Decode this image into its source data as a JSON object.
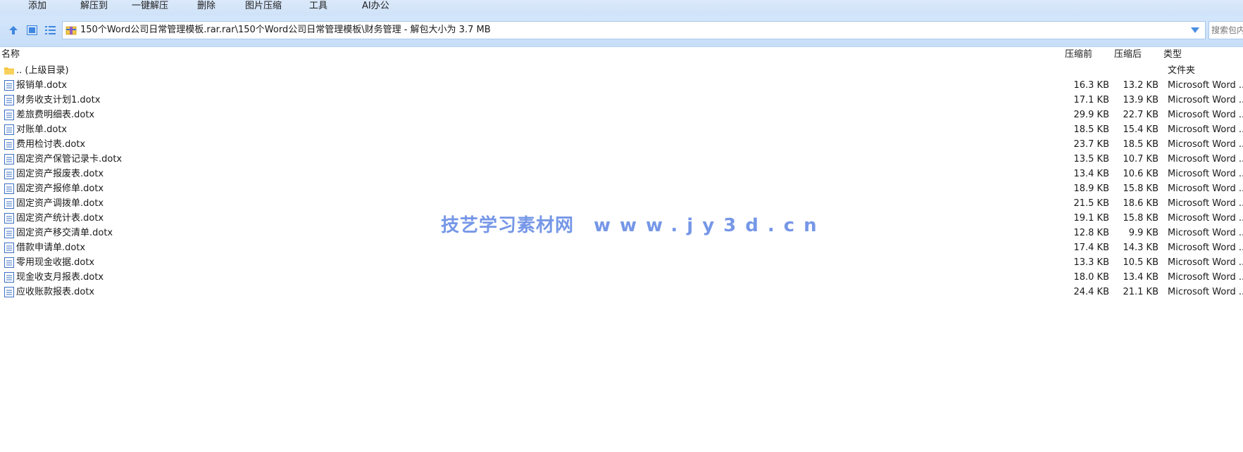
{
  "menu": {
    "items": [
      "添加",
      "解压到",
      "一键解压",
      "删除",
      "图片压缩",
      "工具",
      "AI办公"
    ]
  },
  "address": {
    "path": "150个Word公司日常管理模板.rar.rar\\150个Word公司日常管理模板\\财务管理 - 解包大小为 3.7 MB",
    "search_placeholder": "搜索包内"
  },
  "columns": {
    "name": "名称",
    "packed": "压缩前",
    "unpacked": "压缩后",
    "type": "类型"
  },
  "rows": [
    {
      "name": ".. (上级目录)",
      "packed": "",
      "unpacked": "",
      "type": "文件夹",
      "icon": "folder-icon"
    },
    {
      "name": "报销单.dotx",
      "packed": "16.3 KB",
      "unpacked": "13.2 KB",
      "type": "Microsoft Word ...",
      "icon": "document-icon"
    },
    {
      "name": "财务收支计划1.dotx",
      "packed": "17.1 KB",
      "unpacked": "13.9 KB",
      "type": "Microsoft Word ...",
      "icon": "document-icon"
    },
    {
      "name": "差旅费明细表.dotx",
      "packed": "29.9 KB",
      "unpacked": "22.7 KB",
      "type": "Microsoft Word ...",
      "icon": "document-icon"
    },
    {
      "name": "对账单.dotx",
      "packed": "18.5 KB",
      "unpacked": "15.4 KB",
      "type": "Microsoft Word ...",
      "icon": "document-icon"
    },
    {
      "name": "费用检讨表.dotx",
      "packed": "23.7 KB",
      "unpacked": "18.5 KB",
      "type": "Microsoft Word ...",
      "icon": "document-icon"
    },
    {
      "name": "固定资产保管记录卡.dotx",
      "packed": "13.5 KB",
      "unpacked": "10.7 KB",
      "type": "Microsoft Word ...",
      "icon": "document-icon"
    },
    {
      "name": "固定资产报废表.dotx",
      "packed": "13.4 KB",
      "unpacked": "10.6 KB",
      "type": "Microsoft Word ...",
      "icon": "document-icon"
    },
    {
      "name": "固定资产报修单.dotx",
      "packed": "18.9 KB",
      "unpacked": "15.8 KB",
      "type": "Microsoft Word ...",
      "icon": "document-icon"
    },
    {
      "name": "固定资产调拨单.dotx",
      "packed": "21.5 KB",
      "unpacked": "18.6 KB",
      "type": "Microsoft Word ...",
      "icon": "document-icon"
    },
    {
      "name": "固定资产统计表.dotx",
      "packed": "19.1 KB",
      "unpacked": "15.8 KB",
      "type": "Microsoft Word ...",
      "icon": "document-icon"
    },
    {
      "name": "固定资产移交清单.dotx",
      "packed": "12.8 KB",
      "unpacked": "9.9 KB",
      "type": "Microsoft Word ...",
      "icon": "document-icon"
    },
    {
      "name": "借款申请单.dotx",
      "packed": "17.4 KB",
      "unpacked": "14.3 KB",
      "type": "Microsoft Word ...",
      "icon": "document-icon"
    },
    {
      "name": "零用现金收据.dotx",
      "packed": "13.3 KB",
      "unpacked": "10.5 KB",
      "type": "Microsoft Word ...",
      "icon": "document-icon"
    },
    {
      "name": "现金收支月报表.dotx",
      "packed": "18.0 KB",
      "unpacked": "13.4 KB",
      "type": "Microsoft Word ...",
      "icon": "document-icon"
    },
    {
      "name": "应收账款报表.dotx",
      "packed": "24.4 KB",
      "unpacked": "21.1 KB",
      "type": "Microsoft Word ...",
      "icon": "document-icon"
    }
  ],
  "watermark": {
    "brand": "技艺学习素材网",
    "url": "www.jy3d.cn"
  },
  "colors": {
    "accent": "#4a8fe0",
    "watermark": "#6b8fe6",
    "toolbar_bg": "#cfe2f8"
  }
}
